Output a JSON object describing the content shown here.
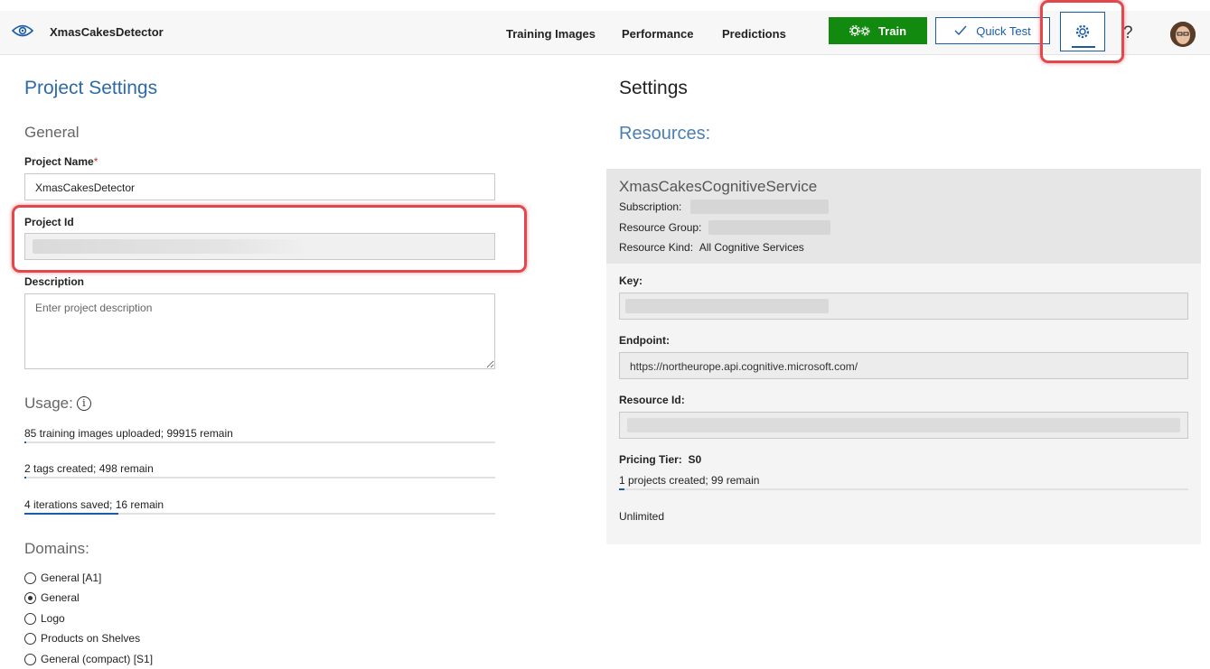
{
  "app": {
    "title": "XmasCakesDetector"
  },
  "nav": {
    "training_images": "Training Images",
    "performance": "Performance",
    "predictions": "Predictions"
  },
  "toolbar": {
    "train_label": "Train",
    "quick_test_label": "Quick Test",
    "help_label": "?"
  },
  "left": {
    "title": "Project Settings",
    "general_heading": "General",
    "project_name_label": "Project Name",
    "required_mark": "*",
    "project_name_value": "XmasCakesDetector",
    "project_id_label": "Project Id",
    "description_label": "Description",
    "description_placeholder": "Enter project description",
    "usage_heading": "Usage:",
    "usage_info_glyph": "i",
    "usage": [
      {
        "text": "85 training images uploaded; 99915 remain",
        "fraction": 0.00085
      },
      {
        "text": "2 tags created; 498 remain",
        "fraction": 0.004
      },
      {
        "text": "4 iterations saved; 16 remain",
        "fraction": 0.2
      }
    ],
    "domains_heading": "Domains:",
    "domains": [
      {
        "label": "General [A1]",
        "selected": false
      },
      {
        "label": "General",
        "selected": true
      },
      {
        "label": "Logo",
        "selected": false
      },
      {
        "label": "Products on Shelves",
        "selected": false
      },
      {
        "label": "General (compact) [S1]",
        "selected": false
      }
    ]
  },
  "right": {
    "title": "Settings",
    "resources_heading": "Resources:",
    "resource_name": "XmasCakesCognitiveService",
    "subscription_label": "Subscription:",
    "resource_group_label": "Resource Group:",
    "resource_kind_label": "Resource Kind:",
    "resource_kind_value": "All Cognitive Services",
    "key_label": "Key:",
    "endpoint_label": "Endpoint:",
    "endpoint_value": "https://northeurope.api.cognitive.microsoft.com/",
    "resource_id_label": "Resource Id:",
    "pricing_tier_label": "Pricing Tier:",
    "pricing_tier_value": "S0",
    "projects_usage": {
      "text": "1 projects created; 99 remain",
      "fraction": 0.01
    },
    "limit_text": "Unlimited"
  },
  "colors": {
    "accent": "#1b5ca8",
    "train_green": "#118a0f",
    "highlight_red": "#e2474b",
    "title_blue": "#2d6aa6"
  },
  "icons": {
    "brand": "eye-icon",
    "train": "gears-icon",
    "quick_test": "checkmark-icon",
    "settings": "gear-icon",
    "info": "info-icon"
  }
}
